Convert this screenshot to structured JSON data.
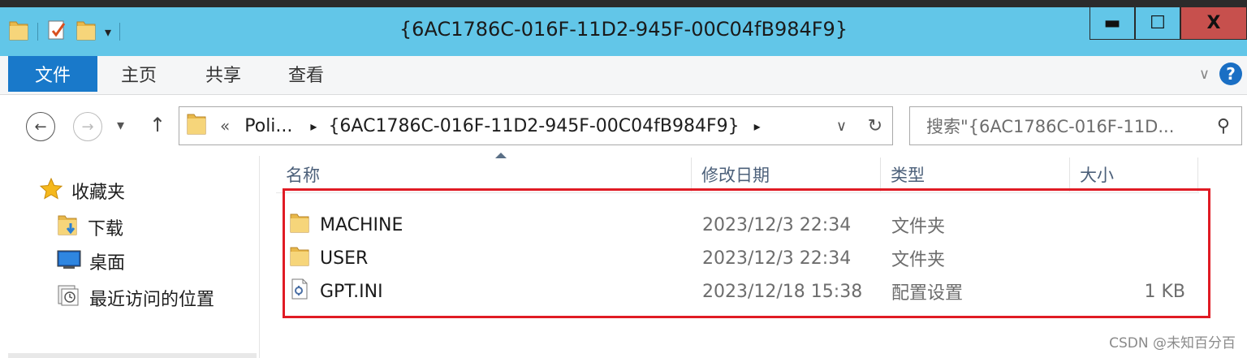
{
  "window": {
    "title": "{6AC1786C-016F-11D2-945F-00C04fB984F9}",
    "minimize_glyph": "▬",
    "maximize_glyph": "☐",
    "close_glyph": "X"
  },
  "ribbon": {
    "tabs": [
      {
        "label": "文件"
      },
      {
        "label": "主页"
      },
      {
        "label": "共享"
      },
      {
        "label": "查看"
      }
    ],
    "expand_glyph": "∨",
    "help_glyph": "?"
  },
  "navigation": {
    "back_glyph": "←",
    "forward_glyph": "→",
    "recent_glyph": "▾",
    "up_glyph": "↑",
    "address": {
      "overflow": "«",
      "segments": [
        "Poli...",
        "{6AC1786C-016F-11D2-945F-00C04fB984F9}"
      ],
      "separator": "▸",
      "dropdown_glyph": "∨",
      "refresh_glyph": "↻"
    },
    "search": {
      "placeholder": "搜索\"{6AC1786C-016F-11D...",
      "icon_glyph": "⚲"
    }
  },
  "sidebar": {
    "items": [
      {
        "label": "收藏夹",
        "icon": "star-icon"
      },
      {
        "label": "下载",
        "icon": "downloads-folder-icon"
      },
      {
        "label": "桌面",
        "icon": "desktop-icon"
      },
      {
        "label": "最近访问的位置",
        "icon": "recent-places-icon"
      }
    ]
  },
  "file_list": {
    "columns": [
      {
        "label": "名称"
      },
      {
        "label": "修改日期"
      },
      {
        "label": "类型"
      },
      {
        "label": "大小"
      }
    ],
    "rows": [
      {
        "name": "MACHINE",
        "date": "2023/12/3 22:34",
        "type": "文件夹",
        "size": "",
        "icon": "folder-icon"
      },
      {
        "name": "USER",
        "date": "2023/12/3 22:34",
        "type": "文件夹",
        "size": "",
        "icon": "folder-icon"
      },
      {
        "name": "GPT.INI",
        "date": "2023/12/18 15:38",
        "type": "配置设置",
        "size": "1 KB",
        "icon": "config-file-icon"
      }
    ]
  },
  "colors": {
    "titlebar": "#62c6e8",
    "file_tab": "#1979ca",
    "close_button": "#c7504d",
    "highlight_box": "#e01b24"
  },
  "watermark": "CSDN @未知百分百"
}
